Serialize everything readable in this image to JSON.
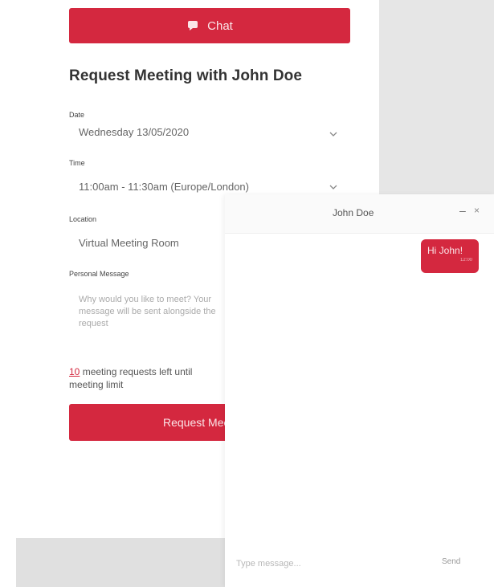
{
  "meeting_panel": {
    "chat_button": {
      "label": "Chat",
      "icon": "chat-bubble-icon"
    },
    "title": "Request Meeting with John Doe",
    "date": {
      "label": "Date",
      "value": "Wednesday 13/05/2020"
    },
    "time": {
      "label": "Time",
      "value": "11:00am - 11:30am (Europe/London)"
    },
    "location": {
      "label": "Location",
      "value": "Virtual Meeting Room"
    },
    "personal_message": {
      "label": "Personal Message",
      "placeholder": "Why would you like to meet? Your message will be sent alongside the request"
    },
    "requests_left": {
      "count": "10",
      "text": "meeting requests left until meeting limit"
    },
    "request_button": {
      "label": "Request Meeting"
    }
  },
  "chat_window": {
    "contact_name": "John Doe",
    "messages": [
      {
        "text": "Hi John!",
        "time": "12:00"
      }
    ],
    "input_placeholder": "Type message...",
    "send_label": "Send"
  },
  "colors": {
    "accent": "#d4283f",
    "grey_block": "#e6e6e6",
    "text": "#333333"
  }
}
